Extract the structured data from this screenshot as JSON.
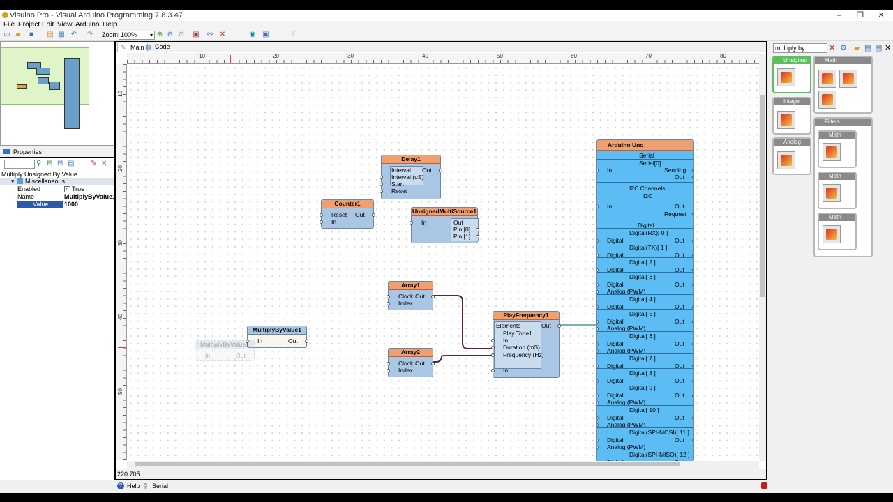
{
  "window": {
    "title": "Visuino Pro - Visual Arduino Programming 7.8.3.47"
  },
  "menu": [
    "File",
    "Project",
    "Edit",
    "View",
    "Arduino",
    "Help"
  ],
  "toolbar": {
    "zoom_label": "Zoom:",
    "zoom_value": "100%"
  },
  "tabs": [
    {
      "label": "Main"
    },
    {
      "label": "Code"
    }
  ],
  "properties": {
    "tab_label": "Properties",
    "object_label": "Multiply Unsigned By Value",
    "category": "Miscellaneous",
    "rows": [
      {
        "name": "Enabled",
        "value": "True"
      },
      {
        "name": "Name",
        "value": "MultiplyByValue1"
      },
      {
        "name": "Value",
        "value": "1000"
      }
    ]
  },
  "ruler": {
    "top": [
      "10",
      "20",
      "30",
      "40",
      "50",
      "60",
      "70",
      "80"
    ],
    "left": [
      "10",
      "20",
      "30",
      "40",
      "50"
    ]
  },
  "status": {
    "coords": "220:705"
  },
  "bottom": {
    "help": "Help",
    "serial": "Serial"
  },
  "search": {
    "value": "multiply by"
  },
  "palette": {
    "groups": [
      "Unsigned",
      "Math",
      "Integer",
      "Filters",
      "Analog"
    ],
    "sub": [
      "Math",
      "Math",
      "Math"
    ]
  },
  "components": {
    "delay": {
      "title": "Delay1",
      "pins": [
        "Interval",
        "Interval (uS)",
        "Start",
        "Reset"
      ],
      "out": "Out"
    },
    "counter": {
      "title": "Counter1",
      "pins": [
        "Reset",
        "In"
      ],
      "out": "Out"
    },
    "multisource": {
      "title": "UnsignedMultiSource1",
      "in": "In",
      "outs": [
        "Out",
        "Pin [0]",
        "Pin [1]"
      ]
    },
    "array1": {
      "title": "Array1",
      "pins": [
        "Clock",
        "Index"
      ],
      "out": "Out"
    },
    "array2": {
      "title": "Array2",
      "pins": [
        "Clock",
        "Index"
      ],
      "out": "Out"
    },
    "multiply": {
      "title": "MultiplyByValue1",
      "in": "In",
      "out": "Out"
    },
    "ghost": {
      "title": "MultiplyByValue1",
      "in": "In",
      "out": "Out"
    },
    "playfreq": {
      "title": "PlayFrequency1",
      "elements": "Elements",
      "tone": "Play Tone1",
      "pins": [
        "In",
        "Duration (mS)",
        "Frequency (Hz)",
        "In"
      ],
      "out": "Out"
    },
    "arduino": {
      "title": "Arduino Uno",
      "serial": "Serial",
      "serial0": "Serial[0]",
      "serial_in": "In",
      "sending": "Sending",
      "serial_out": "Out",
      "i2c": "I2C Channels",
      "i2c_label": "I2C",
      "i2c_in": "In",
      "i2c_out": "Out",
      "request": "Request",
      "digital": "Digital",
      "channels": [
        {
          "label": "Digital(RX)[ 0 ]",
          "pwm": false
        },
        {
          "label": "Digital(TX)[ 1 ]",
          "pwm": false
        },
        {
          "label": "Digital[ 2 ]",
          "pwm": false
        },
        {
          "label": "Digital[ 3 ]",
          "pwm": true
        },
        {
          "label": "Digital[ 4 ]",
          "pwm": false
        },
        {
          "label": "Digital[ 5 ]",
          "pwm": true
        },
        {
          "label": "Digital[ 6 ]",
          "pwm": true
        },
        {
          "label": "Digital[ 7 ]",
          "pwm": false
        },
        {
          "label": "Digital[ 8 ]",
          "pwm": false
        },
        {
          "label": "Digital[ 9 ]",
          "pwm": true
        },
        {
          "label": "Digital[ 10 ]",
          "pwm": true
        },
        {
          "label": "Digital(SPI-MOSI)[ 11 ]",
          "pwm": true
        },
        {
          "label": "Digital(SPI-MISO)[ 12 ]",
          "pwm": false
        }
      ],
      "pin_digital": "Digital",
      "pin_analog": "Analog (PWM)",
      "pin_out": "Out"
    }
  }
}
